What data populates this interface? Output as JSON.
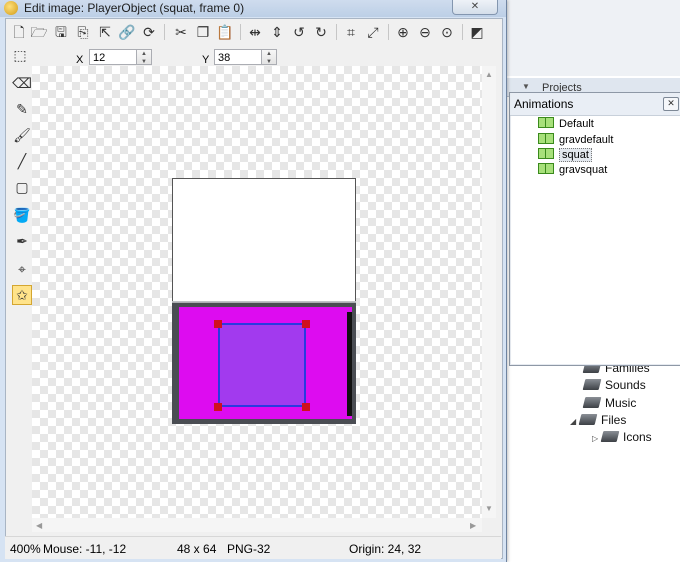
{
  "window": {
    "title": "Edit image: PlayerObject (squat, frame 0)",
    "close_glyph": "✕"
  },
  "toolbar": {
    "icons": [
      "new-icon",
      "open-icon",
      "save-icon",
      "save-copy-icon",
      "export-icon",
      "link-icon",
      "refresh-icon",
      "cut-icon",
      "copy-icon",
      "paste-icon",
      "flip-horizontal-icon",
      "flip-vertical-icon",
      "rotate-left-icon",
      "rotate-right-icon",
      "crop-icon",
      "resize-icon",
      "zoom-in-icon",
      "zoom-out-icon",
      "zoom-actual-icon",
      "transparency-icon"
    ]
  },
  "coords": {
    "x_label": "X",
    "x_value": "12",
    "y_label": "Y",
    "y_value": "38"
  },
  "tools": [
    "rectangle-select-icon",
    "eraser-icon",
    "pencil-icon",
    "brush-icon",
    "line-icon",
    "rectangle-icon",
    "fill-icon",
    "color-picker-icon",
    "hotspot-icon",
    "collision-polygon-icon"
  ],
  "status": {
    "zoom": "400%",
    "mouse": "Mouse: -11, -12",
    "size": "48 x 64",
    "format": "PNG-32",
    "origin": "Origin: 24, 32"
  },
  "animations": {
    "title": "Animations",
    "close_glyph": "✕",
    "items": [
      "Default",
      "gravdefault",
      "squat",
      "gravsquat"
    ],
    "selected": "squat"
  },
  "projects": {
    "header": "Projects",
    "tree": [
      {
        "label": "Families"
      },
      {
        "label": "Sounds"
      },
      {
        "label": "Music"
      },
      {
        "label": "Files"
      },
      {
        "label": "Icons"
      }
    ]
  },
  "colors": {
    "sprite_fill": "#dd0cf0",
    "collision_fill": "#a23aee",
    "collision_border": "#2a3ae0",
    "handle": "#d0101e",
    "sprite_frame": "#4a4d53"
  }
}
